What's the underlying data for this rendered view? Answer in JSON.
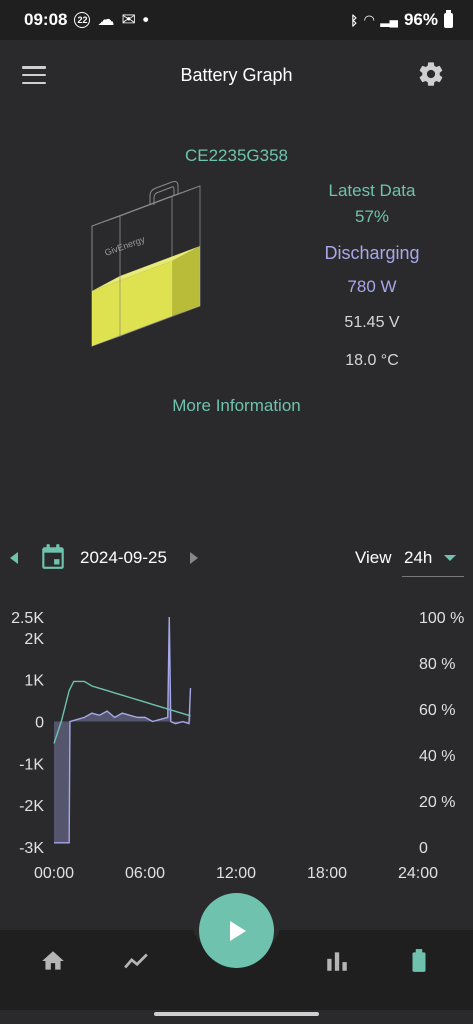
{
  "status_bar": {
    "time": "09:08",
    "badge": "22",
    "battery": "96%"
  },
  "app_bar": {
    "title": "Battery Graph"
  },
  "device": {
    "serial": "CE2235G358",
    "brand_label": "GivEnergy"
  },
  "info": {
    "latest_label": "Latest Data",
    "soc": "57%",
    "state": "Discharging",
    "power": "780 W",
    "voltage": "51.45 V",
    "temperature": "18.0 °C"
  },
  "more_info_label": "More Information",
  "date_bar": {
    "date": "2024-09-25",
    "view_label": "View",
    "view_value": "24h"
  },
  "colors": {
    "accent": "#6fc2ad",
    "purple": "#a7a7ea",
    "battery_fill": "#e9ec52"
  },
  "chart_data": {
    "type": "line",
    "left_axis": {
      "ticks": [
        "2.5K",
        "2K",
        "1K",
        "0",
        "-1K",
        "-2K",
        "-3K"
      ],
      "ylim": [
        -3000,
        2500
      ]
    },
    "right_axis": {
      "ticks": [
        "100 %",
        "80 %",
        "60 %",
        "40 %",
        "20 %",
        "0"
      ],
      "ylim": [
        0,
        100
      ]
    },
    "x_ticks": [
      "00:00",
      "06:00",
      "12:00",
      "18:00",
      "24:00"
    ],
    "xlim_hours": [
      0,
      24
    ],
    "series": [
      {
        "axis": "right",
        "color": "#6fc2ad",
        "points": [
          [
            0.0,
            45
          ],
          [
            0.5,
            55
          ],
          [
            1.0,
            68
          ],
          [
            1.3,
            72
          ],
          [
            2.0,
            72
          ],
          [
            2.5,
            70
          ],
          [
            3.0,
            69
          ],
          [
            3.5,
            68
          ],
          [
            4.0,
            67
          ],
          [
            4.5,
            66
          ],
          [
            5.0,
            65
          ],
          [
            5.5,
            64
          ],
          [
            6.0,
            63
          ],
          [
            6.5,
            62
          ],
          [
            7.0,
            61
          ],
          [
            7.5,
            60
          ],
          [
            8.0,
            59
          ],
          [
            8.5,
            58
          ],
          [
            9.0,
            57
          ]
        ]
      },
      {
        "axis": "left",
        "color": "#a7a7ea",
        "points": [
          [
            0.0,
            -2900
          ],
          [
            1.0,
            -2900
          ],
          [
            1.05,
            0
          ],
          [
            2.0,
            100
          ],
          [
            2.5,
            200
          ],
          [
            3.0,
            150
          ],
          [
            3.5,
            250
          ],
          [
            4.0,
            100
          ],
          [
            4.5,
            200
          ],
          [
            5.0,
            150
          ],
          [
            5.5,
            100
          ],
          [
            6.0,
            100
          ],
          [
            6.5,
            0
          ],
          [
            7.0,
            50
          ],
          [
            7.5,
            100
          ],
          [
            7.6,
            2500
          ],
          [
            7.7,
            0
          ],
          [
            8.0,
            -50
          ],
          [
            8.5,
            0
          ],
          [
            8.9,
            -50
          ],
          [
            9.0,
            800
          ]
        ]
      }
    ]
  },
  "nav": {
    "items": [
      "home",
      "chart",
      "bar-chart",
      "battery"
    ]
  }
}
